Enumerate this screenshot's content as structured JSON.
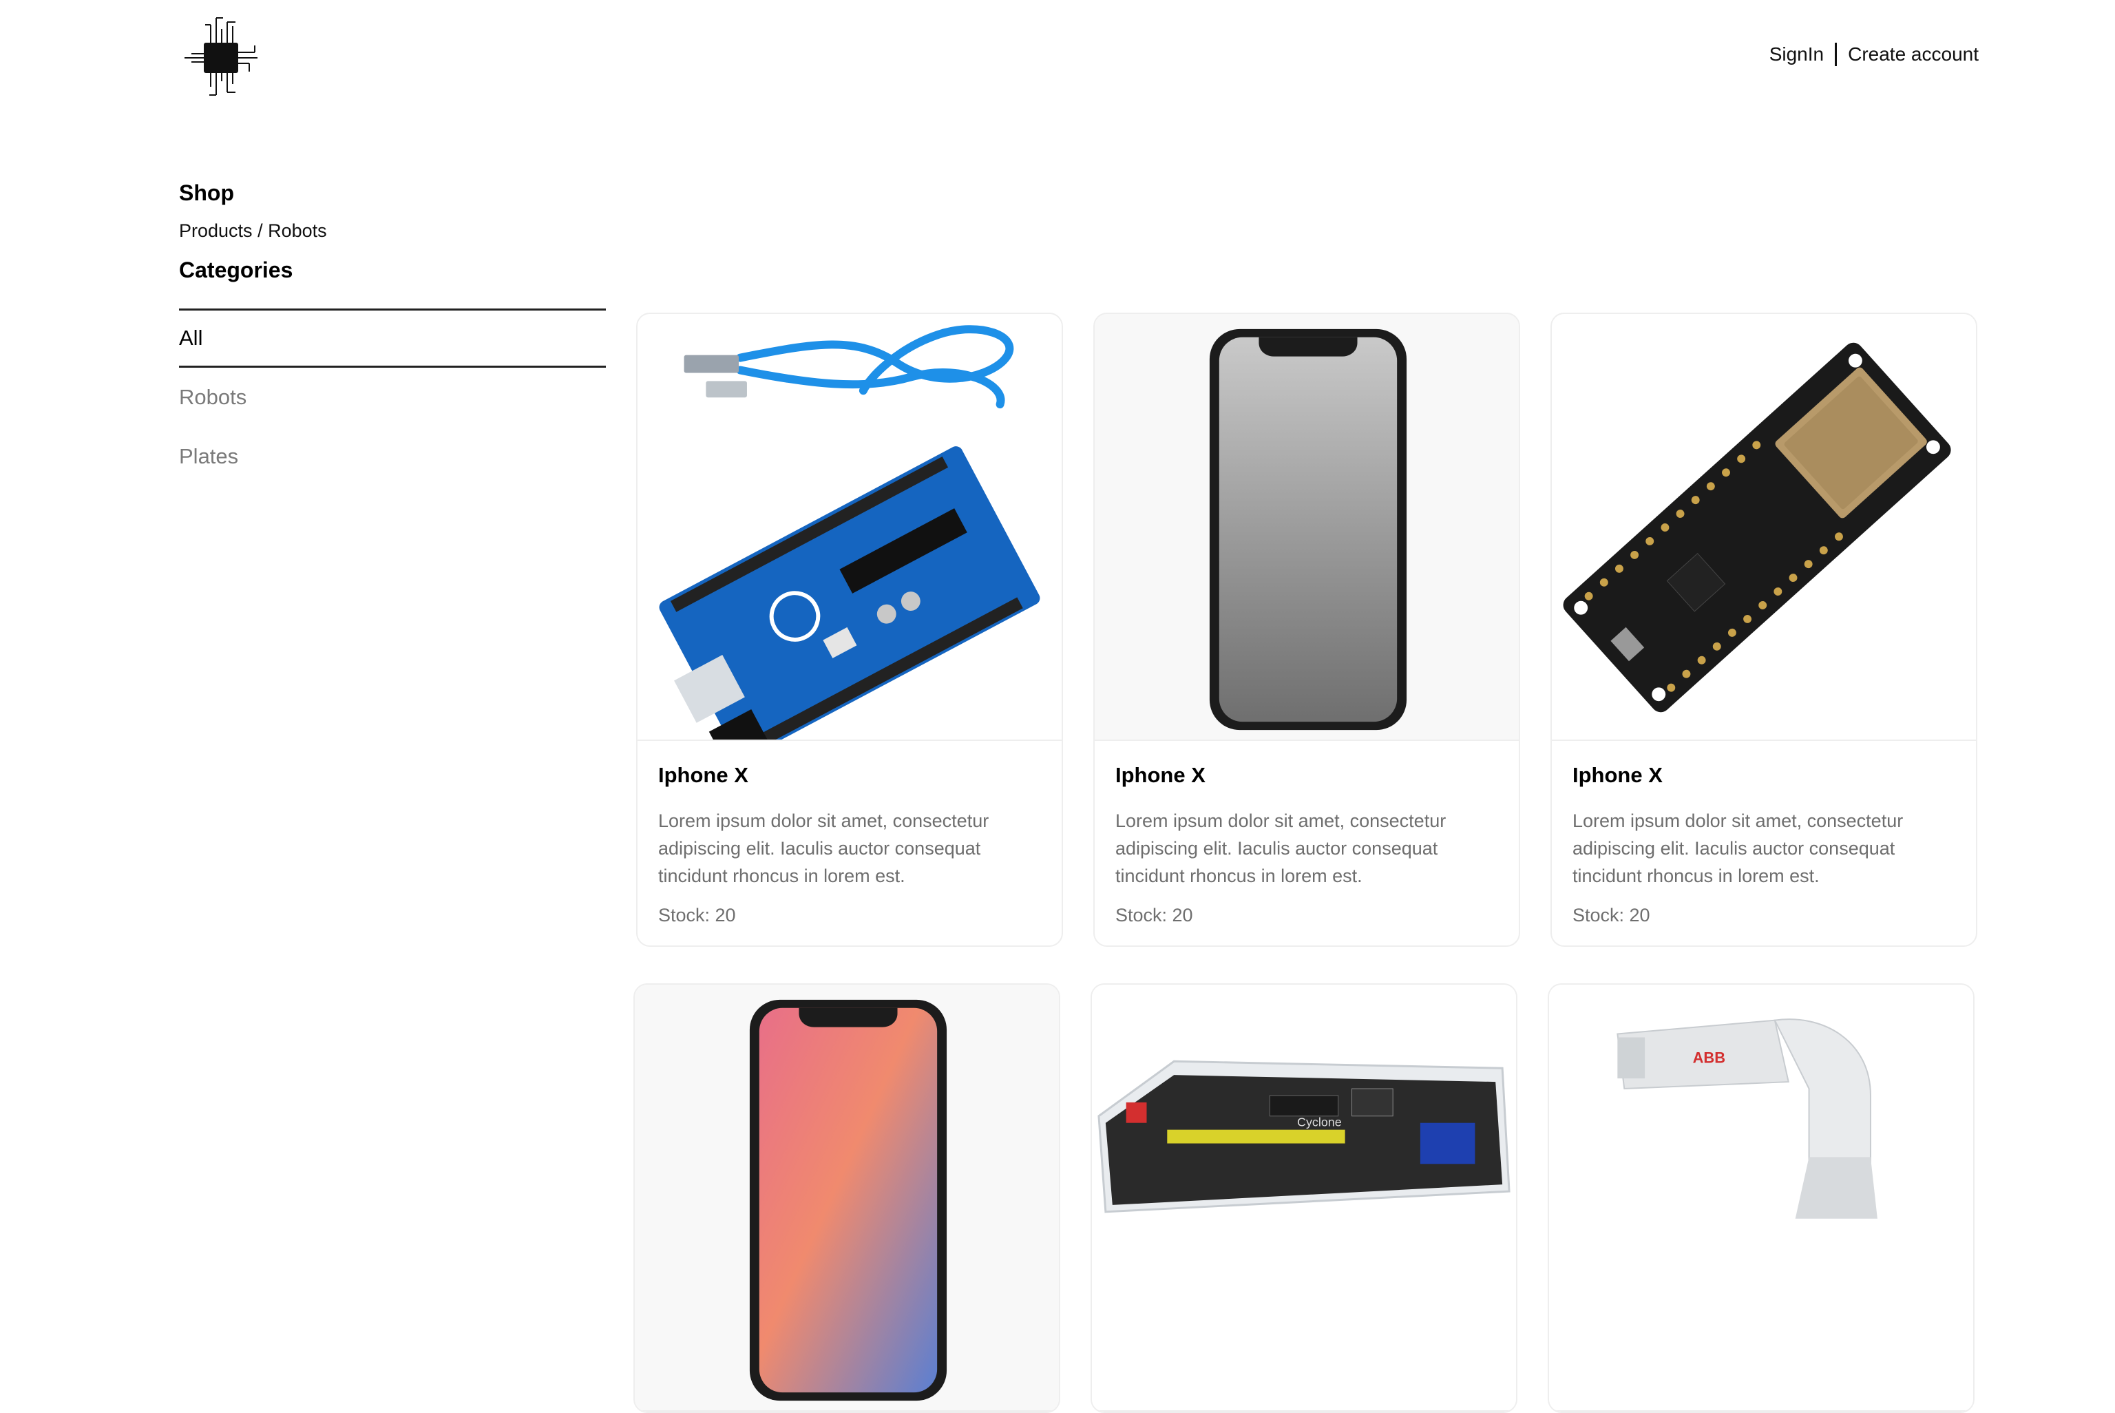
{
  "header": {
    "signin_label": "SignIn",
    "create_account_label": "Create account"
  },
  "sidebar": {
    "shop_title": "Shop",
    "breadcrumb": {
      "products": "Products",
      "separator": " / ",
      "current": "Robots"
    },
    "categories_title": "Categories",
    "categories": [
      {
        "label": "All",
        "active": true
      },
      {
        "label": "Robots",
        "active": false
      },
      {
        "label": "Plates",
        "active": false
      }
    ]
  },
  "products": [
    {
      "title": "Iphone X",
      "description": "Lorem ipsum dolor sit amet, consectetur adipiscing elit. Iaculis auctor consequat tincidunt rhoncus in lorem est.",
      "stock": "Stock: 20",
      "image": "arduino-board"
    },
    {
      "title": "Iphone X",
      "description": "Lorem ipsum dolor sit amet, consectetur adipiscing elit. Iaculis auctor consequat tincidunt rhoncus in lorem est.",
      "stock": "Stock: 20",
      "image": "phone-gray"
    },
    {
      "title": "Iphone X",
      "description": "Lorem ipsum dolor sit amet, consectetur adipiscing elit. Iaculis auctor consequat tincidunt rhoncus in lorem est.",
      "stock": "Stock: 20",
      "image": "esp32-board"
    },
    {
      "image": "phone-gradient"
    },
    {
      "image": "fpga-board",
      "board_label": "Cyclone"
    },
    {
      "image": "robot-arm",
      "brand_label": "ABB"
    }
  ],
  "colors": {
    "text": "#000000",
    "muted": "#6e6e6e",
    "card_border": "#eeeeee",
    "image_bg": "#f8f8f8"
  }
}
